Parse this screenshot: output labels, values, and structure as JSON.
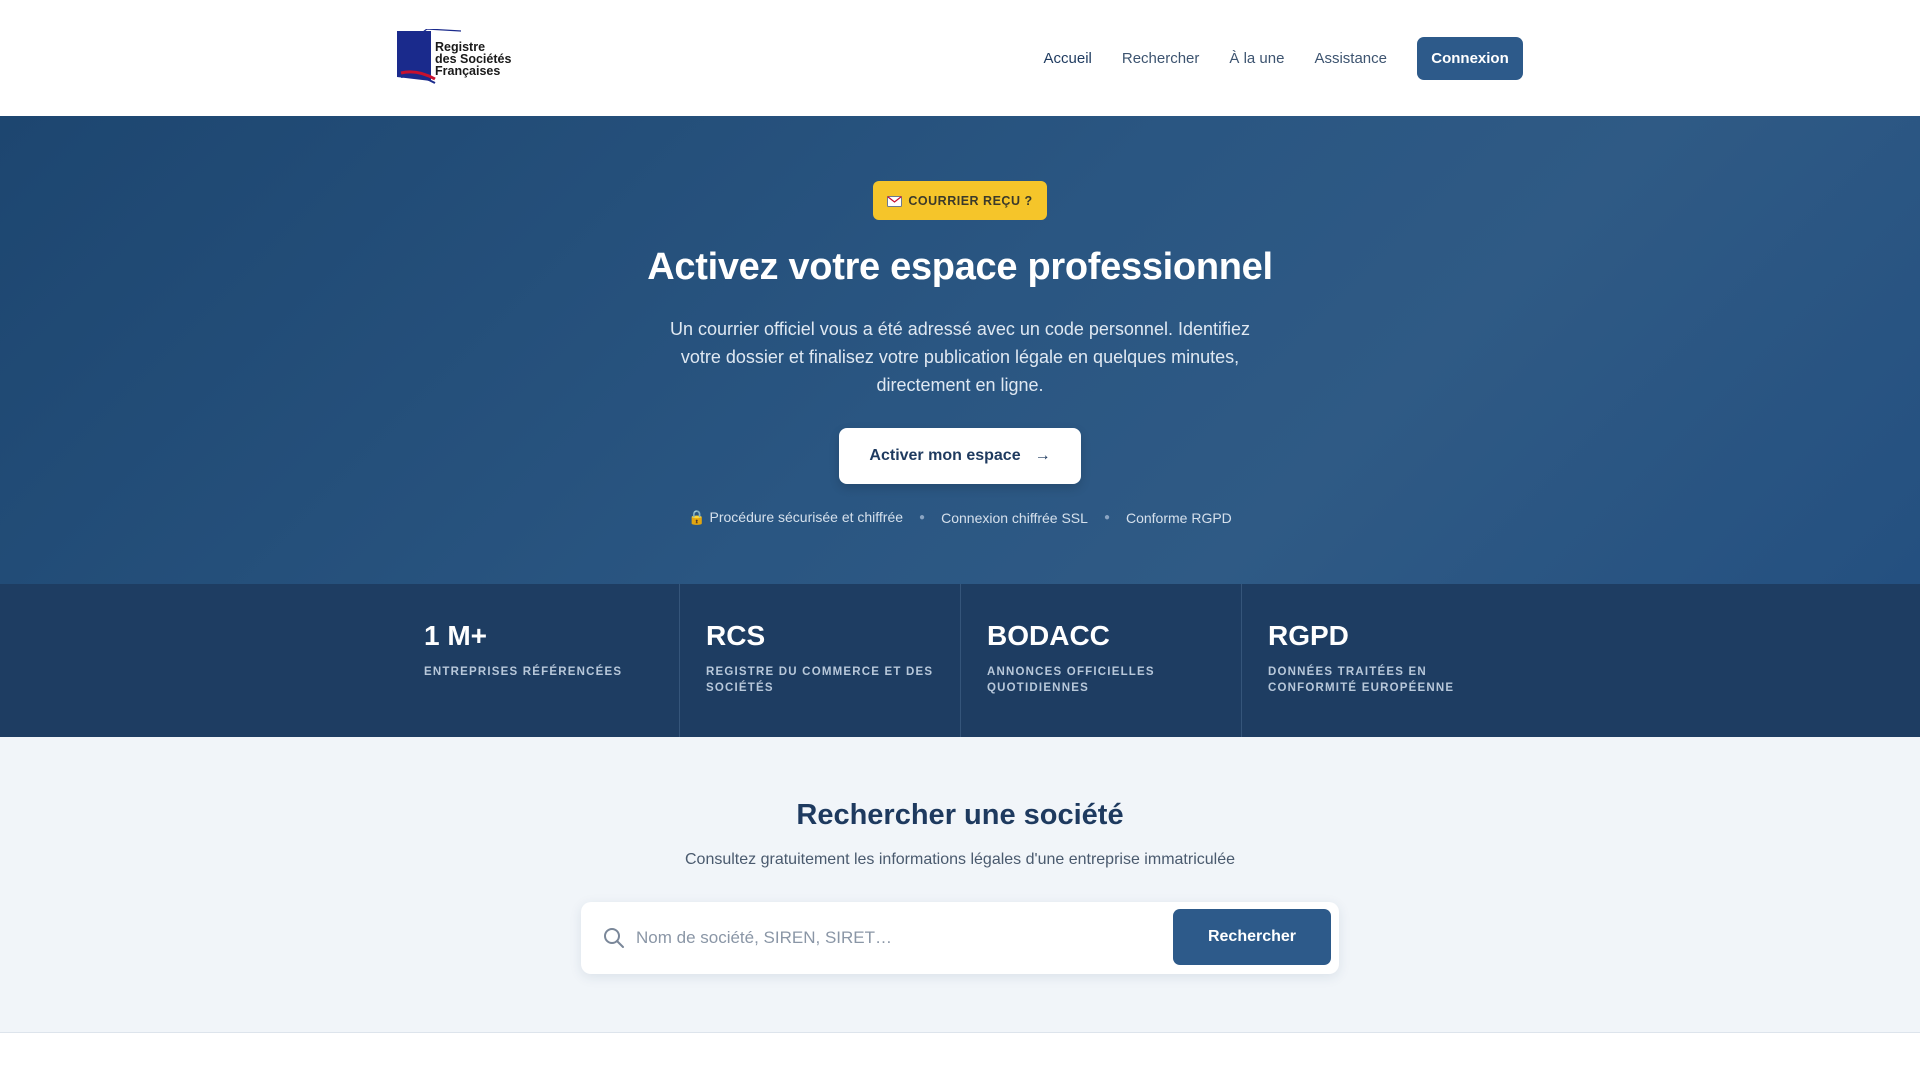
{
  "logo": {
    "text": "Registre\ndes Sociétés\nFrançaises"
  },
  "nav": {
    "items": [
      "Accueil",
      "Rechercher",
      "À la une",
      "Assistance"
    ],
    "login_label": "Connexion"
  },
  "hero": {
    "badge": "COURRIER REÇU ?",
    "badge_icon": "envelope-icon",
    "title": "Activez votre espace professionnel",
    "subtitle": "Un courrier officiel vous a été adressé avec un code personnel. Identifiez votre dossier et finalisez votre publication légale en quelques minutes, directement en ligne.",
    "cta_label": "Activer mon espace",
    "trust": [
      "🔒 Procédure sécurisée et chiffrée",
      "Connexion chiffrée SSL",
      "Conforme RGPD"
    ]
  },
  "stats": [
    {
      "value": "1 M+",
      "label": "ENTREPRISES RÉFÉRENCÉES"
    },
    {
      "value": "RCS",
      "label": "REGISTRE DU COMMERCE ET DES SOCIÉTÉS"
    },
    {
      "value": "BODACC",
      "label": "ANNONCES OFFICIELLES QUOTIDIENNES"
    },
    {
      "value": "RGPD",
      "label": "DONNÉES TRAITÉES EN CONFORMITÉ EUROPÉENNE"
    }
  ],
  "search": {
    "title": "Rechercher une société",
    "subtitle": "Consultez gratuitement les informations légales d'une entreprise immatriculée",
    "placeholder": "Nom de société, SIREN, SIRET…",
    "button_label": "Rechercher"
  },
  "colors": {
    "primary": "#2d5a8a",
    "navy": "#1e3d62",
    "badge": "#f5c52a"
  }
}
